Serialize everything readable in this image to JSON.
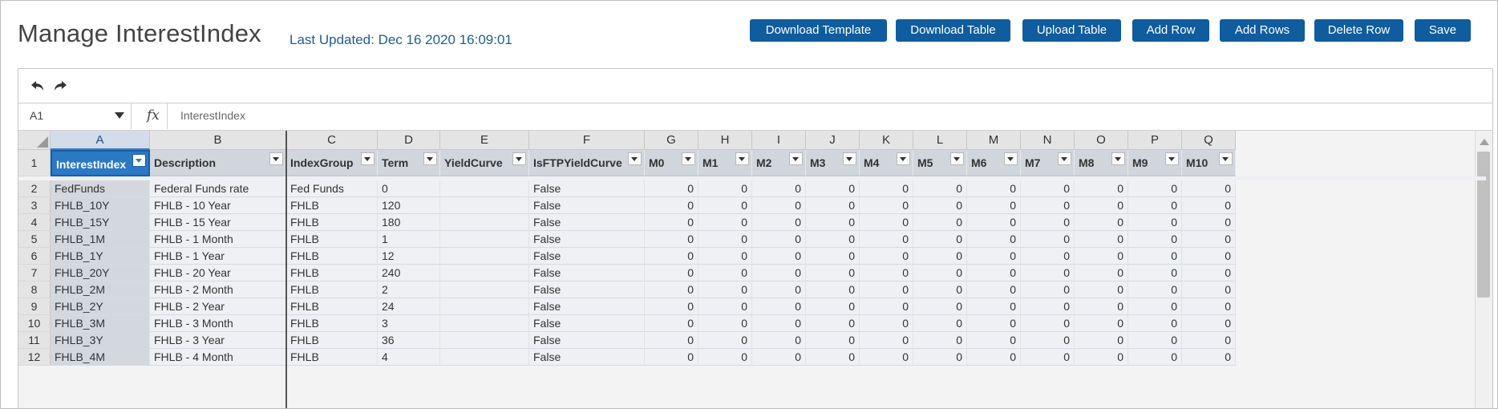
{
  "header": {
    "title": "Manage InterestIndex",
    "last_updated": "Last Updated: Dec 16 2020 16:09:01"
  },
  "toolbar": {
    "buttons": [
      {
        "label": "Download Template"
      },
      {
        "label": "Download Table"
      },
      {
        "label": "Upload Table"
      },
      {
        "label": "Add Row"
      },
      {
        "label": "Add Rows"
      },
      {
        "label": "Delete Row"
      },
      {
        "label": "Save"
      }
    ]
  },
  "sheet": {
    "undo_icon": "undo-arrow-icon",
    "redo_icon": "redo-arrow-icon",
    "namebox": "A1",
    "fx_symbol": "fx",
    "formula_value": "InterestIndex",
    "column_letters": [
      "A",
      "B",
      "C",
      "D",
      "E",
      "F",
      "G",
      "H",
      "I",
      "J",
      "K",
      "L",
      "M",
      "N",
      "O",
      "P",
      "Q"
    ],
    "header_row_number": "1",
    "headers": [
      "InterestIndex",
      "Description",
      "IndexGroup",
      "Term",
      "YieldCurve",
      "IsFTPYieldCurve",
      "M0",
      "M1",
      "M2",
      "M3",
      "M4",
      "M5",
      "M6",
      "M7",
      "M8",
      "M9",
      "M10"
    ],
    "rows": [
      {
        "num": "2",
        "cells": [
          "FedFunds",
          "Federal Funds rate",
          "Fed Funds",
          "0",
          "",
          "False",
          "0",
          "0",
          "0",
          "0",
          "0",
          "0",
          "0",
          "0",
          "0",
          "0",
          "0"
        ]
      },
      {
        "num": "3",
        "cells": [
          "FHLB_10Y",
          "FHLB - 10 Year",
          "FHLB",
          "120",
          "",
          "False",
          "0",
          "0",
          "0",
          "0",
          "0",
          "0",
          "0",
          "0",
          "0",
          "0",
          "0"
        ]
      },
      {
        "num": "4",
        "cells": [
          "FHLB_15Y",
          "FHLB - 15 Year",
          "FHLB",
          "180",
          "",
          "False",
          "0",
          "0",
          "0",
          "0",
          "0",
          "0",
          "0",
          "0",
          "0",
          "0",
          "0"
        ]
      },
      {
        "num": "5",
        "cells": [
          "FHLB_1M",
          "FHLB - 1 Month",
          "FHLB",
          "1",
          "",
          "False",
          "0",
          "0",
          "0",
          "0",
          "0",
          "0",
          "0",
          "0",
          "0",
          "0",
          "0"
        ]
      },
      {
        "num": "6",
        "cells": [
          "FHLB_1Y",
          "FHLB - 1 Year",
          "FHLB",
          "12",
          "",
          "False",
          "0",
          "0",
          "0",
          "0",
          "0",
          "0",
          "0",
          "0",
          "0",
          "0",
          "0"
        ]
      },
      {
        "num": "7",
        "cells": [
          "FHLB_20Y",
          "FHLB - 20 Year",
          "FHLB",
          "240",
          "",
          "False",
          "0",
          "0",
          "0",
          "0",
          "0",
          "0",
          "0",
          "0",
          "0",
          "0",
          "0"
        ]
      },
      {
        "num": "8",
        "cells": [
          "FHLB_2M",
          "FHLB - 2 Month",
          "FHLB",
          "2",
          "",
          "False",
          "0",
          "0",
          "0",
          "0",
          "0",
          "0",
          "0",
          "0",
          "0",
          "0",
          "0"
        ]
      },
      {
        "num": "9",
        "cells": [
          "FHLB_2Y",
          "FHLB - 2 Year",
          "FHLB",
          "24",
          "",
          "False",
          "0",
          "0",
          "0",
          "0",
          "0",
          "0",
          "0",
          "0",
          "0",
          "0",
          "0"
        ]
      },
      {
        "num": "10",
        "cells": [
          "FHLB_3M",
          "FHLB - 3 Month",
          "FHLB",
          "3",
          "",
          "False",
          "0",
          "0",
          "0",
          "0",
          "0",
          "0",
          "0",
          "0",
          "0",
          "0",
          "0"
        ]
      },
      {
        "num": "11",
        "cells": [
          "FHLB_3Y",
          "FHLB - 3 Year",
          "FHLB",
          "36",
          "",
          "False",
          "0",
          "0",
          "0",
          "0",
          "0",
          "0",
          "0",
          "0",
          "0",
          "0",
          "0"
        ]
      },
      {
        "num": "12",
        "cells": [
          "FHLB_4M",
          "FHLB - 4 Month",
          "FHLB",
          "4",
          "",
          "False",
          "0",
          "0",
          "0",
          "0",
          "0",
          "0",
          "0",
          "0",
          "0",
          "0",
          "0"
        ]
      }
    ]
  },
  "colors": {
    "accent": "#0f5c9e",
    "link_text": "#1f5e95",
    "active_header": "#2b78c4",
    "header_fill": "#d1d6dd"
  }
}
